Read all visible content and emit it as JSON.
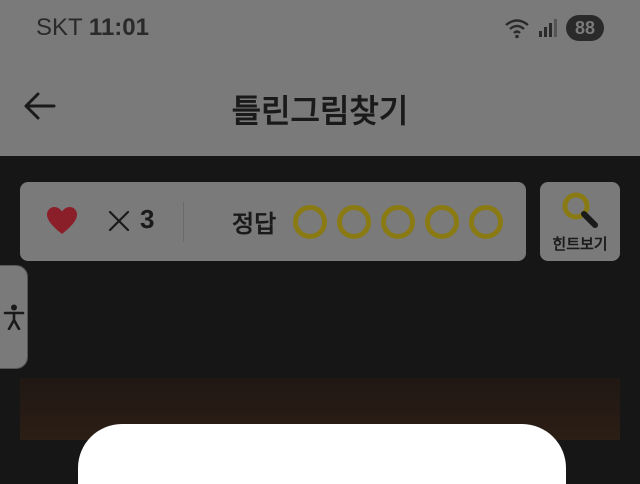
{
  "status_bar": {
    "carrier": "SKT",
    "time": "11:01",
    "battery": "88",
    "icons": [
      "wifi-icon",
      "signal-icon",
      "battery-icon"
    ]
  },
  "header": {
    "title": "틀린그림찾기",
    "back_icon": "arrow-left-icon"
  },
  "score": {
    "lives_icon": "heart-icon",
    "multiply_symbol": "✕",
    "lives_count": "3",
    "answer_label": "정답",
    "answers_total": 5,
    "answers_found": 0
  },
  "hint": {
    "label": "힌트보기",
    "icon": "magnifier-icon"
  },
  "accessibility": {
    "icon": "accessibility-icon"
  },
  "colors": {
    "overlay_gray": "#7a7a7a",
    "background": "#161616",
    "heart": "#8a1f2a",
    "slot_gold": "#8a7a14",
    "text_dark": "#1a1a1a",
    "sheet": "#ffffff"
  }
}
